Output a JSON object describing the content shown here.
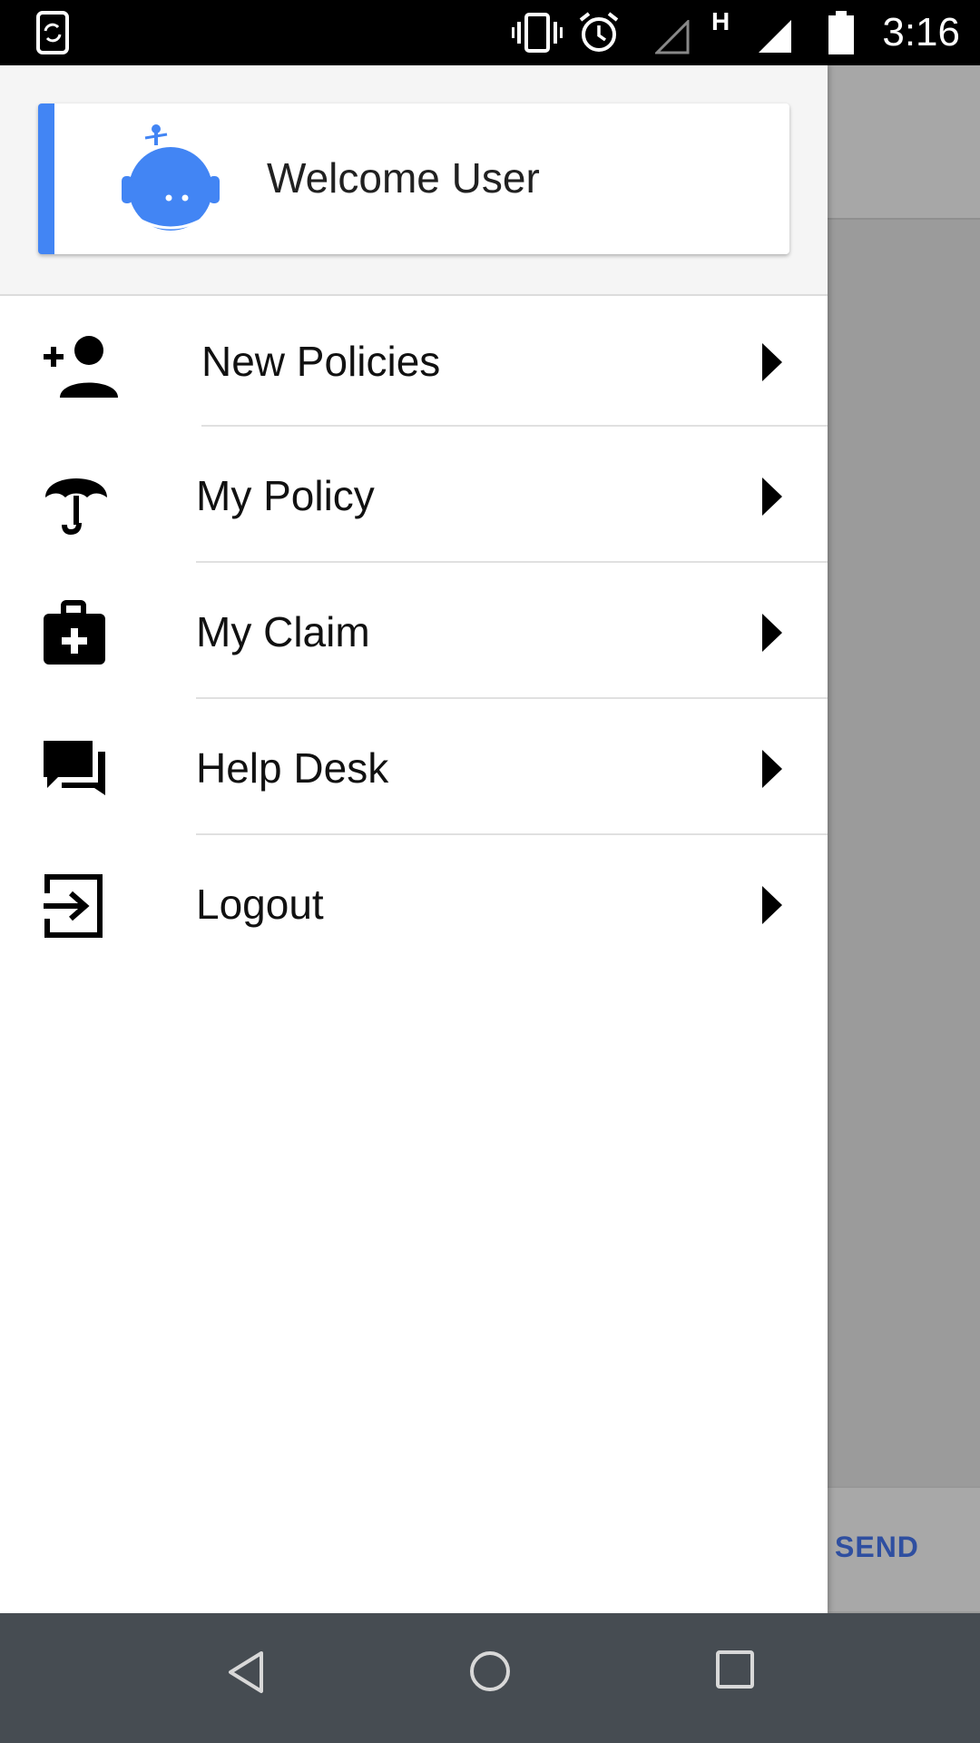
{
  "status_bar": {
    "time": "3:16",
    "network_label": "H",
    "icons": [
      "screen-rotation-icon",
      "vibrate-icon",
      "alarm-icon",
      "signal-empty-icon",
      "signal-full-icon",
      "battery-icon"
    ]
  },
  "drawer": {
    "header": {
      "welcome_text": "Welcome User",
      "accent_color": "#4285f4"
    },
    "items": [
      {
        "label": "New Policies",
        "icon": "add-person-icon"
      },
      {
        "label": "My Policy",
        "icon": "umbrella-icon"
      },
      {
        "label": "My Claim",
        "icon": "medical-kit-icon"
      },
      {
        "label": "Help Desk",
        "icon": "chat-icon"
      },
      {
        "label": "Logout",
        "icon": "exit-icon"
      }
    ]
  },
  "background": {
    "send_label": "SEND"
  },
  "nav_bar": {
    "icons": [
      "back-icon",
      "home-icon",
      "recents-icon"
    ]
  }
}
